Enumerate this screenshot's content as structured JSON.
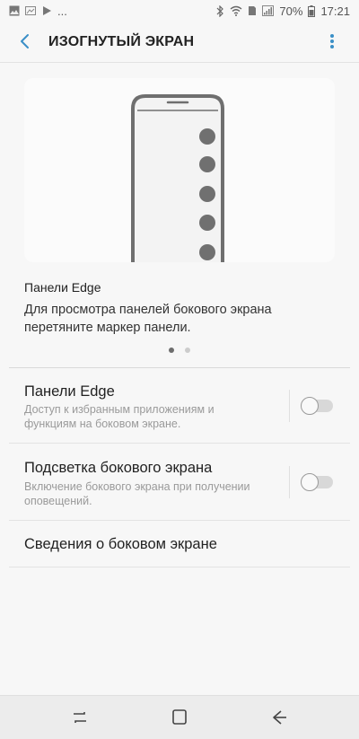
{
  "status_bar": {
    "left_icons": [
      "gallery-icon",
      "image-icon",
      "play-store-icon"
    ],
    "overflow": "...",
    "right_icons": [
      "bluetooth-icon",
      "wifi-icon",
      "sim-icon",
      "signal-icon"
    ],
    "battery": "70%",
    "time": "17:21"
  },
  "appbar": {
    "title": "ИЗОГНУТЫЙ ЭКРАН",
    "accent_color": "#3a8fc7"
  },
  "intro": {
    "title": "Панели Edge",
    "description": "Для просмотра панелей бокового экрана перетяните маркер панели.",
    "page_count": 2,
    "active_page": 1
  },
  "settings": [
    {
      "title": "Панели Edge",
      "description": "Доступ к избранным приложениям и функциям на боковом экране.",
      "toggle": false
    },
    {
      "title": "Подсветка бокового экрана",
      "description": "Включение бокового экрана при получении оповещений.",
      "toggle": false
    },
    {
      "title": "Сведения о боковом экране"
    }
  ],
  "navbar": {
    "buttons": [
      "recent-apps-icon",
      "home-icon",
      "back-icon"
    ]
  }
}
